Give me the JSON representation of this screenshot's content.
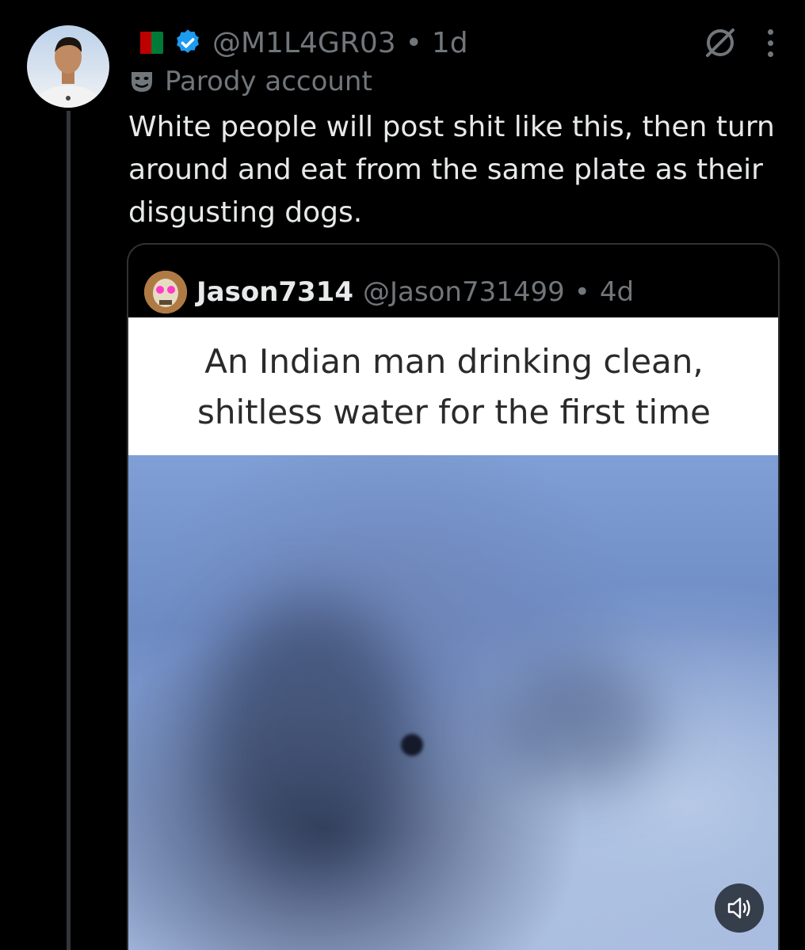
{
  "post": {
    "handle": "@M1L4GR03",
    "separator": "•",
    "time": "1d",
    "label": "Parody account",
    "text": "White people will post shit like this, then turn around and eat from the same plate as their disgusting dogs."
  },
  "quoted_post": {
    "display_name": "Jason7314",
    "handle": "@Jason731499",
    "separator": "•",
    "time": "4d",
    "meme_caption_line1": "An Indian man drinking clean,",
    "meme_caption_line2": "shitless water for the first time"
  },
  "icons": {
    "flag": "afghanistan-flag-icon",
    "verified": "verified-badge-icon",
    "grok": "grok-icon",
    "more": "more-options-icon",
    "parody": "theater-masks-icon",
    "sound": "speaker-icon"
  },
  "colors": {
    "background": "#000000",
    "text_primary": "#e7e9ea",
    "text_secondary": "#71767b",
    "verified_blue": "#1d9bf0",
    "border": "#2f3336"
  }
}
